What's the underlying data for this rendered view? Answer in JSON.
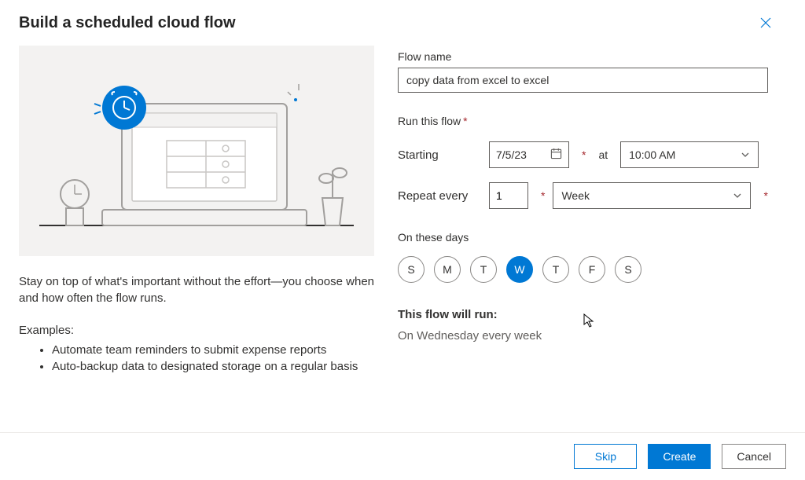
{
  "dialog": {
    "title": "Build a scheduled cloud flow"
  },
  "left": {
    "description": "Stay on top of what's important without the effort—you choose when and how often the flow runs.",
    "examples_label": "Examples:",
    "examples": [
      "Automate team reminders to submit expense reports",
      "Auto-backup data to designated storage on a regular basis"
    ]
  },
  "form": {
    "flow_name_label": "Flow name",
    "flow_name_value": "copy data from excel to excel",
    "run_label": "Run this flow",
    "starting_label": "Starting",
    "starting_date": "7/5/23",
    "at_label": "at",
    "starting_time": "10:00 AM",
    "repeat_label": "Repeat every",
    "repeat_value": "1",
    "repeat_period": "Week",
    "days_label": "On these days",
    "days": [
      {
        "letter": "S",
        "selected": false
      },
      {
        "letter": "M",
        "selected": false
      },
      {
        "letter": "T",
        "selected": false
      },
      {
        "letter": "W",
        "selected": true
      },
      {
        "letter": "T",
        "selected": false
      },
      {
        "letter": "F",
        "selected": false
      },
      {
        "letter": "S",
        "selected": false
      }
    ],
    "will_run_label": "This flow will run:",
    "will_run_text": "On Wednesday every week"
  },
  "footer": {
    "skip": "Skip",
    "create": "Create",
    "cancel": "Cancel"
  }
}
